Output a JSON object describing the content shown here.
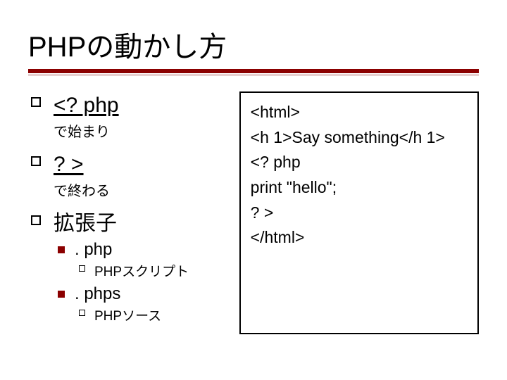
{
  "title": "PHPの動かし方",
  "left": {
    "items": [
      {
        "head": "<? php",
        "underline": true,
        "sub": "で始まり"
      },
      {
        "head": "? >",
        "underline": true,
        "sub": "で終わる"
      },
      {
        "head": "拡張子",
        "underline": false,
        "children": [
          {
            "head": ". php",
            "children": [
              {
                "text": "PHPスクリプト"
              }
            ]
          },
          {
            "head": ". phps",
            "children": [
              {
                "text": "PHPソース"
              }
            ]
          }
        ]
      }
    ]
  },
  "code": {
    "lines": [
      "<html>",
      "<h 1>Say something</h 1>",
      "<? php",
      "print \"hello\";",
      "? >",
      "</html>"
    ]
  }
}
